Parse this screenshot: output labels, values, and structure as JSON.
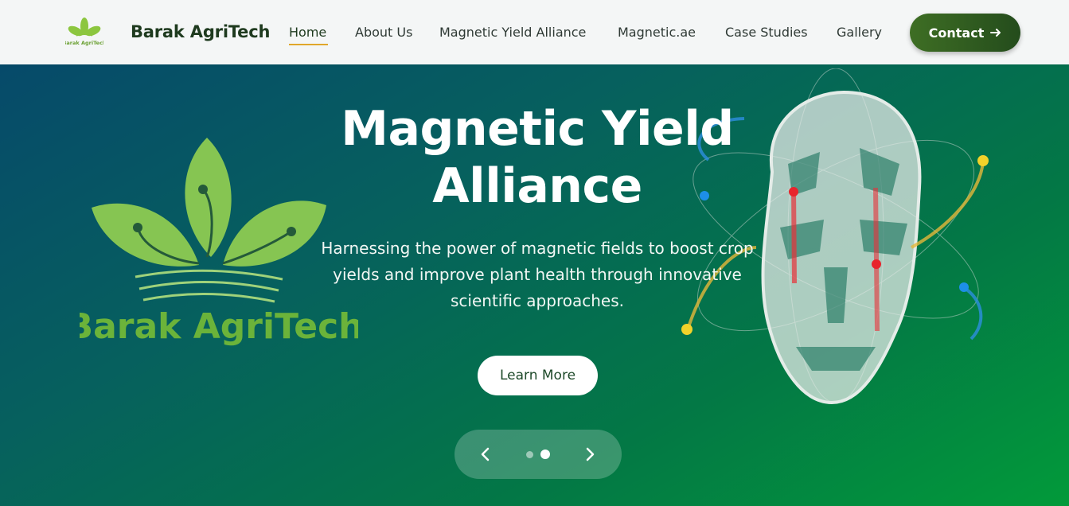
{
  "nav": {
    "brand": "Barak AgriTech",
    "logo_text": "Barak AgriTech",
    "links": [
      {
        "label": "Home",
        "active": true
      },
      {
        "label": "About Us"
      },
      {
        "label": "Magnetic Yield Alliance"
      },
      {
        "label": "Magnetic.ae"
      },
      {
        "label": "Case Studies"
      },
      {
        "label": "Gallery"
      }
    ],
    "contact_label": "Contact",
    "accent_color": "#e0a72b",
    "button_color": "#3e6e24"
  },
  "hero": {
    "title_line1": "Magnetic Yield",
    "title_line2": "Alliance",
    "subtitle_line1": "Harnessing the power of magnetic fields to boost crop",
    "subtitle_line2": "yields and improve plant health through innovative",
    "subtitle_line3": "scientific approaches.",
    "cta_label": "Learn More",
    "logo_text": "Barak AgriTech",
    "slide_count": 2,
    "active_slide": 2,
    "icons": [
      "arrow-right-icon",
      "chevron-left-icon",
      "chevron-right-icon",
      "leaf-logo-icon"
    ]
  }
}
